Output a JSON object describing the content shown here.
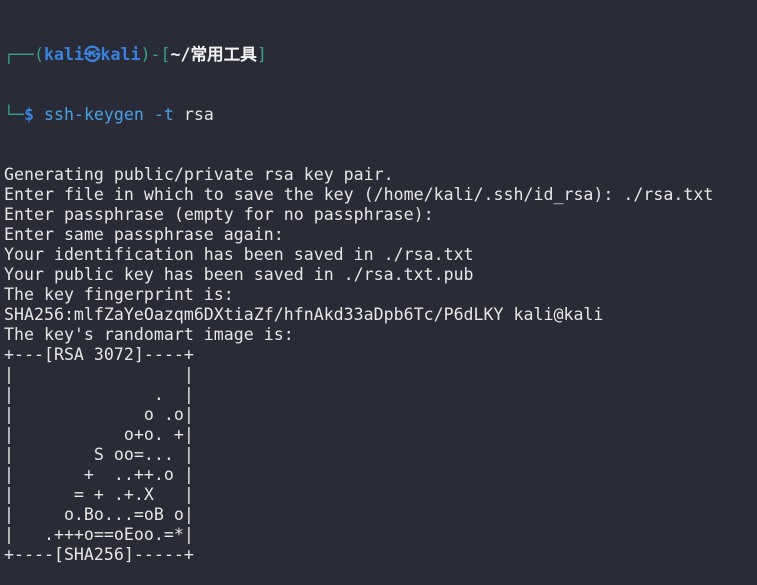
{
  "prompt": {
    "user": "kali",
    "at_symbol": "㉿",
    "host": "kali",
    "cwd": "~/常用工具",
    "symbol": "$",
    "command": "ssh-keygen",
    "flag": "-t",
    "arg": "rsa"
  },
  "output": [
    "Generating public/private rsa key pair.",
    "Enter file in which to save the key (/home/kali/.ssh/id_rsa): ./rsa.txt",
    "Enter passphrase (empty for no passphrase):",
    "Enter same passphrase again:",
    "Your identification has been saved in ./rsa.txt",
    "Your public key has been saved in ./rsa.txt.pub",
    "The key fingerprint is:",
    "SHA256:mlfZaYeOazqm6DXtiaZf/hfnAkd33aDpb6Tc/P6dLKY kali@kali",
    "The key's randomart image is:",
    "+---[RSA 3072]----+",
    "|                 |",
    "|              .  |",
    "|             o .o|",
    "|           o+o. +|",
    "|        S oo=... |",
    "|       +  ..++.o |",
    "|      = + .+.X   |",
    "|     o.Bo...=oB o|",
    "|   .+++o==oEoo.=*|",
    "+----[SHA256]-----+"
  ]
}
